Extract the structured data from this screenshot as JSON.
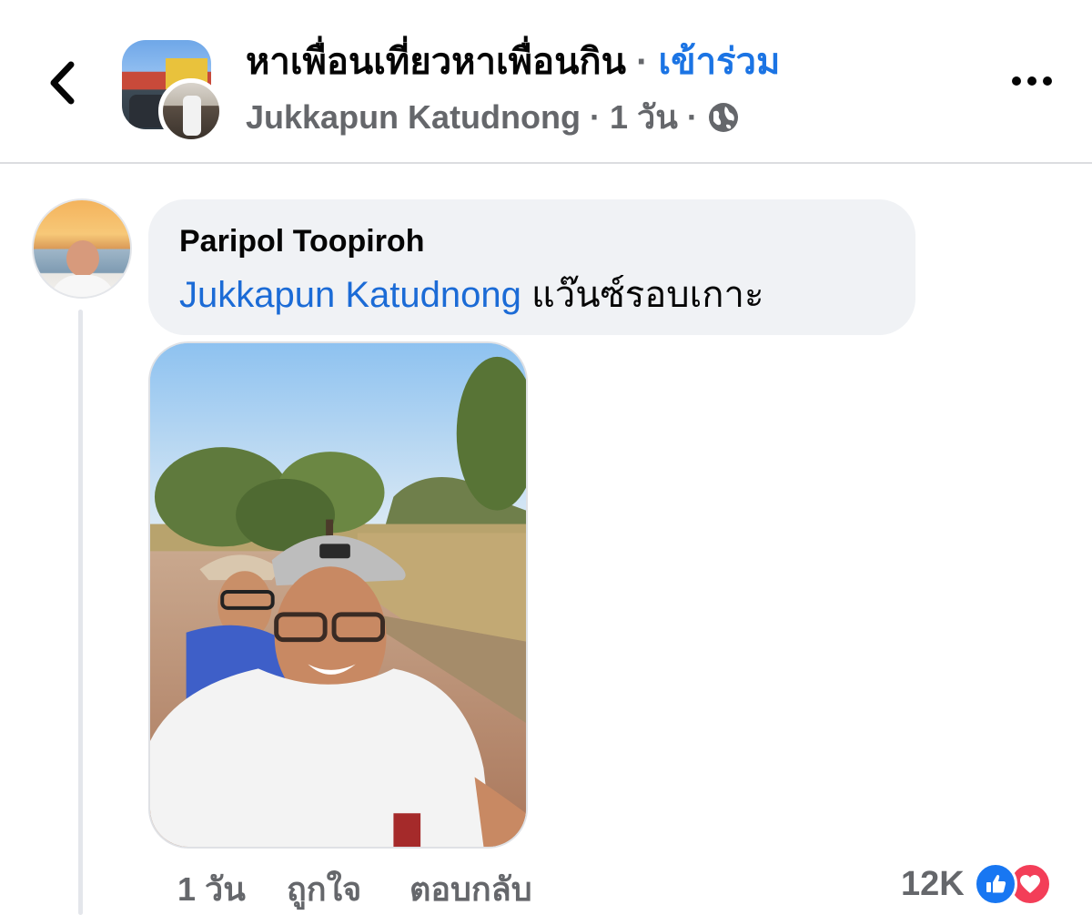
{
  "header": {
    "group_name": "หาเพื่อนเที่ยวหาเพื่อนกิน",
    "separator": "·",
    "join_label": "เข้าร่วม",
    "poster": "Jukkapun Katudnong",
    "time": "1 วัน",
    "back_icon": "chevron-left-icon",
    "more_icon": "more-horizontal-icon",
    "privacy_icon": "globe-icon"
  },
  "comment": {
    "author": "Paripol Toopiroh",
    "mention": "Jukkapun Katudnong",
    "text": "แว๊นซ์รอบเกาะ",
    "actions": {
      "time": "1 วัน",
      "like": "ถูกใจ",
      "reply": "ตอบกลับ"
    },
    "reactions": {
      "count": "12K",
      "icons": [
        "like-icon",
        "love-icon"
      ]
    }
  },
  "colors": {
    "accent": "#1b74e4",
    "mention": "#1b6bd6",
    "secondary_text": "#65676b",
    "bubble": "#f0f2f5",
    "like": "#1877f2",
    "love": "#f33e58"
  }
}
